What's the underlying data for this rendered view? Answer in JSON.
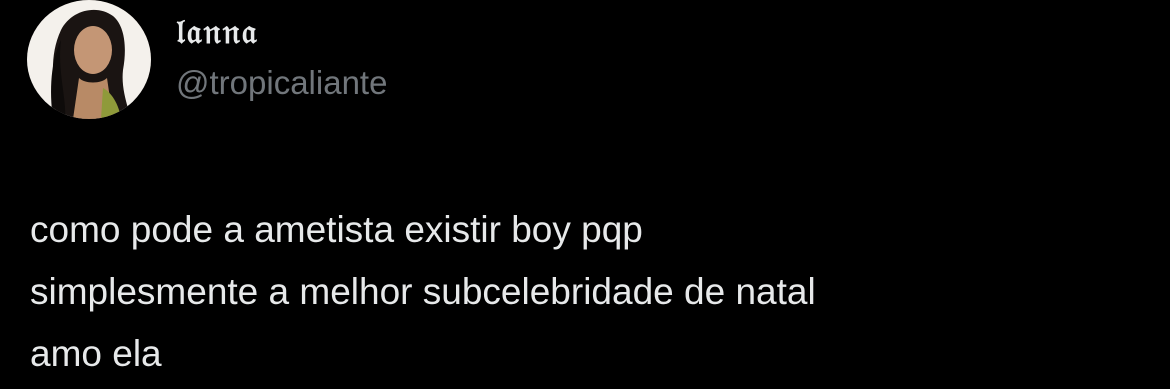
{
  "author": {
    "display_name": "𝔩𝔞𝔫𝔫𝔞",
    "handle": "@tropicaliante"
  },
  "tweet": {
    "lines": [
      "como pode a ametista existir boy pqp",
      "simplesmente a melhor subcelebridade de natal",
      "amo ela"
    ]
  },
  "colors": {
    "background": "#000000",
    "text_primary": "#e7e9ea",
    "text_secondary": "#71767b"
  }
}
